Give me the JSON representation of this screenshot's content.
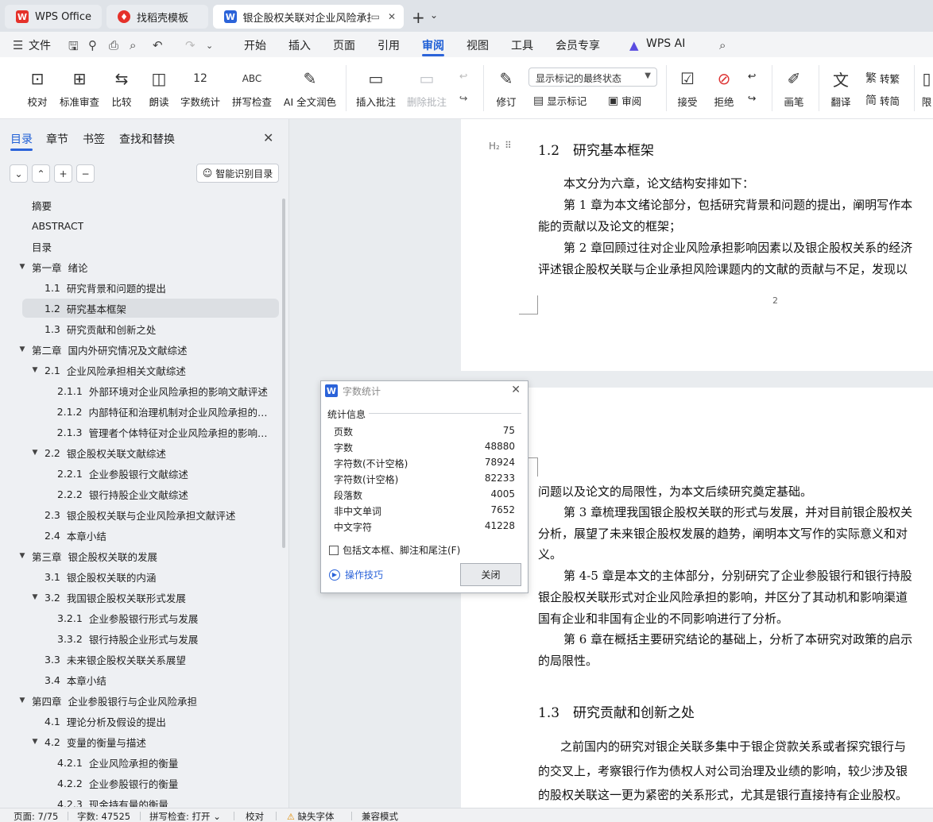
{
  "titlebar": {
    "tabs": [
      {
        "label": "WPS Office",
        "icon": "wps-logo-icon",
        "color": "#e5312a"
      },
      {
        "label": "找稻壳模板",
        "icon": "docer-icon",
        "color": "#e5312a"
      },
      {
        "label": "银企股权关联对企业风险承担",
        "icon": "writer-doc-icon",
        "color": "#2b63d9"
      }
    ]
  },
  "menu": {
    "items": [
      "文件",
      "开始",
      "插入",
      "页面",
      "引用",
      "审阅",
      "视图",
      "工具",
      "会员专享",
      "WPS AI"
    ],
    "active": "审阅"
  },
  "ribbon": {
    "buttons": [
      "校对",
      "标准审查",
      "比较",
      "朗读",
      "字数统计",
      "拼写检查",
      "AI 全文润色",
      "插入批注",
      "删除批注",
      "修订",
      "接受",
      "拒绝",
      "画笔",
      "翻译",
      "限"
    ],
    "display_state": "显示标记的最终状态",
    "show_markup": "显示标记",
    "review": "审阅",
    "to_traditional": "转繁",
    "to_simplified": "转简"
  },
  "sidebar": {
    "tabs": [
      "目录",
      "章节",
      "书签",
      "查找和替换"
    ],
    "smart_button": "智能识别目录",
    "toc": [
      {
        "num": "",
        "label": "摘要"
      },
      {
        "num": "",
        "label": "ABSTRACT"
      },
      {
        "num": "",
        "label": "目录"
      },
      {
        "num": "第一章",
        "label": "绪论"
      },
      {
        "num": "1.1",
        "label": "研究背景和问题的提出"
      },
      {
        "num": "1.2",
        "label": "研究基本框架"
      },
      {
        "num": "1.3",
        "label": "研究贡献和创新之处"
      },
      {
        "num": "第二章",
        "label": "国内外研究情况及文献综述"
      },
      {
        "num": "2.1",
        "label": "企业风险承担相关文献综述"
      },
      {
        "num": "2.1.1",
        "label": "外部环境对企业风险承担的影响文献评述"
      },
      {
        "num": "2.1.2",
        "label": "内部特征和治理机制对企业风险承担的影..."
      },
      {
        "num": "2.1.3",
        "label": "管理者个体特征对企业风险承担的影响文..."
      },
      {
        "num": "2.2",
        "label": "银企股权关联文献综述"
      },
      {
        "num": "2.2.1",
        "label": "企业参股银行文献综述"
      },
      {
        "num": "2.2.2",
        "label": "银行持股企业文献综述"
      },
      {
        "num": "2.3",
        "label": "银企股权关联与企业风险承担文献评述"
      },
      {
        "num": "2.4",
        "label": "本章小结"
      },
      {
        "num": "第三章",
        "label": "银企股权关联的发展"
      },
      {
        "num": "3.1",
        "label": "银企股权关联的内涵"
      },
      {
        "num": "3.2",
        "label": "我国银企股权关联形式发展"
      },
      {
        "num": "3.2.1",
        "label": "企业参股银行形式与发展"
      },
      {
        "num": "3.3.2",
        "label": "银行持股企业形式与发展"
      },
      {
        "num": "3.3",
        "label": "未来银企股权关联关系展望"
      },
      {
        "num": "3.4",
        "label": "本章小结"
      },
      {
        "num": "第四章",
        "label": "企业参股银行与企业风险承担"
      },
      {
        "num": "4.1",
        "label": "理论分析及假设的提出"
      },
      {
        "num": "4.2",
        "label": "变量的衡量与描述"
      },
      {
        "num": "4.2.1",
        "label": "企业风险承担的衡量"
      },
      {
        "num": "4.2.2",
        "label": "企业参股银行的衡量"
      },
      {
        "num": "4.2.3",
        "label": "现金持有量的衡量"
      }
    ]
  },
  "document": {
    "heading_marker": "H₂",
    "h12": "1.2　研究基本框架",
    "p1": [
      "本文分为六章，论文结构安排如下：",
      "第 1 章为本文绪论部分，包括研究背景和问题的提出，阐明写作本",
      "能的贡献以及论文的框架；",
      "第 2 章回顾过往对企业风险承担影响因素以及银企股权关系的经济",
      "评述银企股权关联与企业承担风险课题内的文献的贡献与不足，发现以"
    ],
    "page_number": "2",
    "p2": [
      "问题以及论文的局限性，为本文后续研究奠定基础。",
      "第 3 章梳理我国银企股权关联的形式与发展，并对目前银企股权关",
      "分析，展望了未来银企股权发展的趋势，阐明本文写作的实际意义和对",
      "义。",
      "第 4-5 章是本文的主体部分，分别研究了企业参股银行和银行持股",
      "银企股权关联形式对企业风险承担的影响，并区分了其动机和影响渠道",
      "国有企业和非国有企业的不同影响进行了分析。",
      "第 6 章在概括主要研究结论的基础上，分析了本研究对政策的启示",
      "的局限性。"
    ],
    "h13": "1.3　研究贡献和创新之处",
    "p3": [
      "之前国内的研究对银企关联多集中于银企贷款关系或者探究银行与",
      "的交叉上，考察银行作为债权人对公司治理及业绩的影响，较少涉及银",
      "的股权关联这一更为紧密的关系形式，尤其是银行直接持有企业股权。"
    ]
  },
  "dialog": {
    "title": "字数统计",
    "section": "统计信息",
    "stats": [
      {
        "label": "页数",
        "value": "75"
      },
      {
        "label": "字数",
        "value": "48880"
      },
      {
        "label": "字符数(不计空格)",
        "value": "78924"
      },
      {
        "label": "字符数(计空格)",
        "value": "82233"
      },
      {
        "label": "段落数",
        "value": "4005"
      },
      {
        "label": "非中文单词",
        "value": "7652"
      },
      {
        "label": "中文字符",
        "value": "41228"
      }
    ],
    "checkbox": "包括文本框、脚注和尾注(F)",
    "tip": "操作技巧",
    "close": "关闭"
  },
  "statusbar": {
    "page": "页面: 7/75",
    "words": "字数: 47525",
    "spell": "拼写检查: 打开",
    "proof": "校对",
    "missing_font": "缺失字体",
    "compat": "兼容模式"
  },
  "colors": {
    "accent": "#2b63d9",
    "wps_red": "#e5312a"
  }
}
